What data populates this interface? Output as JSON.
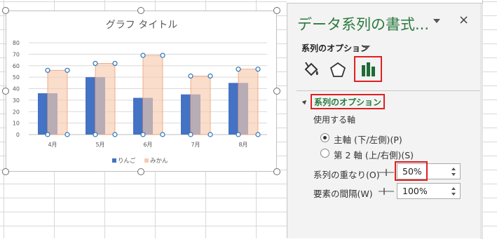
{
  "chart_data": {
    "type": "bar",
    "title": "グラフ タイトル",
    "categories": [
      "4月",
      "5月",
      "6月",
      "7月",
      "8月"
    ],
    "series": [
      {
        "name": "りんご",
        "values": [
          36,
          50,
          32,
          35,
          45
        ],
        "color": "#4472c4"
      },
      {
        "name": "みかん",
        "values": [
          56,
          62,
          69,
          51,
          57
        ],
        "color": "#f8cbad",
        "selected": true
      }
    ],
    "ylim": [
      0,
      80
    ],
    "yticks": [
      "0",
      "10",
      "20",
      "30",
      "40",
      "50",
      "60",
      "70",
      "80"
    ],
    "grid": true,
    "legend_position": "bottom",
    "overlap_percent": 50
  },
  "pane": {
    "title": "データ系列の書式...",
    "close_label": "×",
    "options_dropdown": "系列のオプション",
    "tabs": [
      {
        "name": "fill-line",
        "icon": "paint-bucket-icon"
      },
      {
        "name": "effects",
        "icon": "pentagon-icon"
      },
      {
        "name": "series-options",
        "icon": "bar-chart-icon",
        "selected": true
      }
    ],
    "section_header": "系列のオプション",
    "axis_label": "使用する軸",
    "radio_primary": "主軸 (下/左側)(P)",
    "radio_secondary": "第 2 軸 (上/右側)(S)",
    "overlap_label": "系列の重なり(O)",
    "overlap_value": "50%",
    "gap_label": "要素の間隔(W)",
    "gap_value": "100%",
    "accent_color": "#2a7a3d",
    "highlight_color": "#e0201f"
  }
}
